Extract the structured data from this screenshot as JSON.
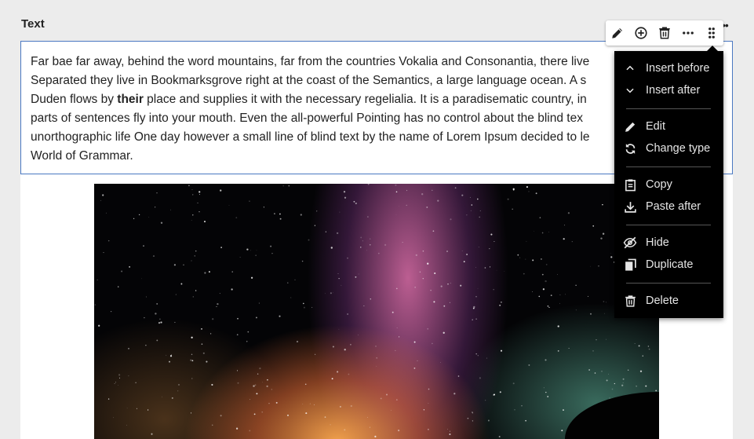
{
  "block": {
    "label": "Text",
    "paragraph_lines": [
      {
        "before": "Far bae far away, behind the word mountains, far from the countries Vokalia and Consonantia, there live",
        "bold": "",
        "after": ""
      },
      {
        "before": "Separated they live in Bookmarksgrove right at the coast of the Semantics, a large language ocean. A s",
        "bold": "",
        "after": ""
      },
      {
        "before": "Duden flows by ",
        "bold": "their",
        "after": " place and supplies it with the necessary regelialia. It is a paradisematic country, in"
      },
      {
        "before": "parts of sentences fly into your mouth. Even the all-powerful Pointing has no control about the blind tex",
        "bold": "",
        "after": ""
      },
      {
        "before": "unorthographic life One day however a small line of blind text by the name of Lorem Ipsum decided to le",
        "bold": "",
        "after": ""
      },
      {
        "before": "World of Grammar.",
        "bold": "",
        "after": ""
      }
    ]
  },
  "toolbar": {
    "buttons": [
      {
        "name": "edit-button",
        "icon": "pencil-icon"
      },
      {
        "name": "insert-button",
        "icon": "plus-circle-icon"
      },
      {
        "name": "delete-button",
        "icon": "trash-icon"
      },
      {
        "name": "more-button",
        "icon": "more-horizontal-icon"
      },
      {
        "name": "drag-handle",
        "icon": "drag-handle-icon"
      }
    ]
  },
  "menu": {
    "items": [
      {
        "label": "Insert before",
        "icon": "chevron-up-icon"
      },
      {
        "label": "Insert after",
        "icon": "chevron-down-icon"
      },
      {
        "label": "Edit",
        "icon": "pencil-icon"
      },
      {
        "label": "Change type",
        "icon": "refresh-icon"
      },
      {
        "label": "Copy",
        "icon": "clipboard-icon"
      },
      {
        "label": "Paste after",
        "icon": "download-icon"
      },
      {
        "label": "Hide",
        "icon": "eye-off-icon"
      },
      {
        "label": "Duplicate",
        "icon": "copy-icon"
      },
      {
        "label": "Delete",
        "icon": "trash-icon"
      }
    ]
  },
  "colors": {
    "page_background": "#ececec",
    "focus_border": "#4a78c2",
    "menu_background": "#000000",
    "menu_text": "#e6e6e6"
  }
}
